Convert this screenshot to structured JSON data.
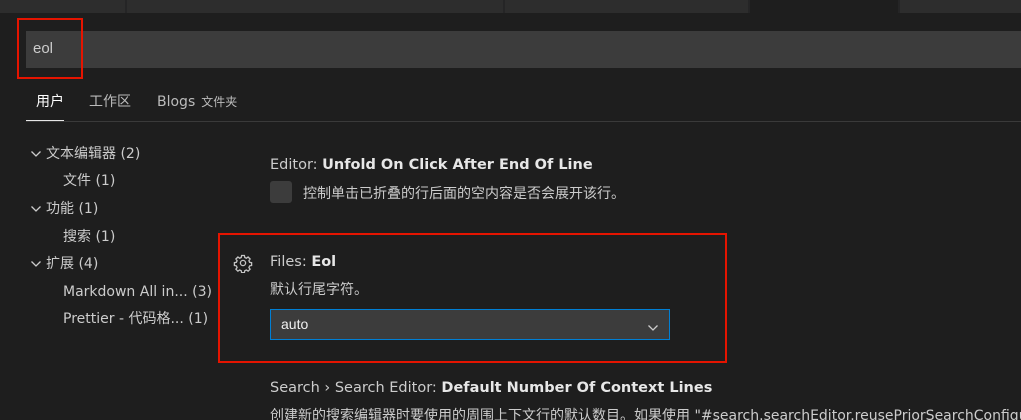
{
  "search": {
    "value": "eol"
  },
  "scope_tabs": {
    "user": "用户",
    "workspace": "工作区",
    "folder": "Blogs",
    "folder_sub": "文件夹"
  },
  "toc": [
    {
      "label": "文本编辑器",
      "count": "(2)",
      "level": 1,
      "expanded": true
    },
    {
      "label": "文件",
      "count": "(1)",
      "level": 2
    },
    {
      "label": "功能",
      "count": "(1)",
      "level": 1,
      "expanded": true
    },
    {
      "label": "搜索",
      "count": "(1)",
      "level": 2
    },
    {
      "label": "扩展",
      "count": "(4)",
      "level": 1,
      "expanded": true
    },
    {
      "label": "Markdown All in...",
      "count": "(3)",
      "level": 2
    },
    {
      "label": "Prettier - 代码格...",
      "count": "(1)",
      "level": 2
    }
  ],
  "settings": [
    {
      "category": "Editor: ",
      "name": "Unfold On Click After End Of Line",
      "description": "控制单击已折叠的行后面的空内容是否会展开该行。",
      "checked": false
    },
    {
      "category": "Files: ",
      "name": "Eol",
      "description": "默认行尾字符。",
      "value": "auto"
    },
    {
      "category": "Search › Search Editor: ",
      "name": "Default Number Of Context Lines",
      "description": "创建新的搜索编辑器时要使用的周围上下文行的默认数目。如果使用 \"#search.searchEditor.reusePriorSearchConfiguration#\""
    }
  ],
  "colors": {
    "background": "#1e1e1e",
    "input": "#3c3c3c",
    "highlight_border": "#e51400",
    "focus_border": "#007fd4"
  }
}
